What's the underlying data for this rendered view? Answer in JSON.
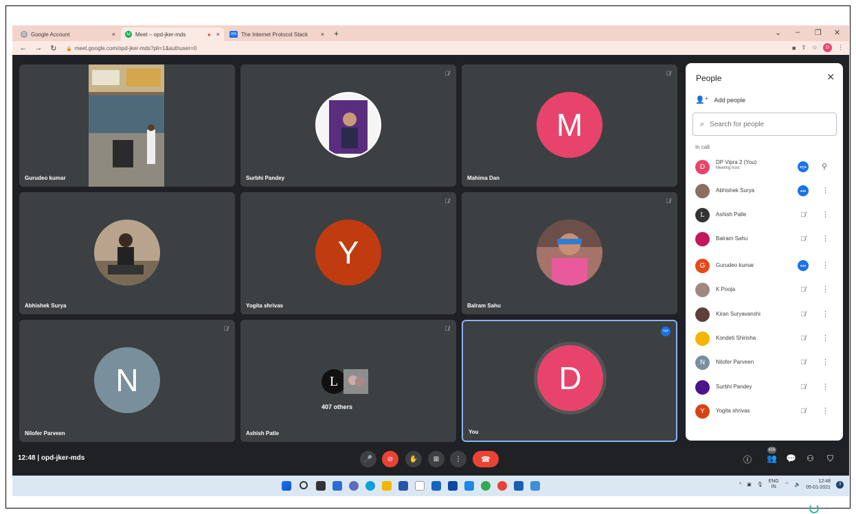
{
  "browser": {
    "tabs": [
      {
        "label": "Google Account",
        "favicon": "G",
        "color": "#9aa0a6",
        "close": "×"
      },
      {
        "label": "Meet – opd-jker-mds",
        "favicon": "M",
        "color": "#00ac47",
        "close": "×",
        "recording": "●"
      },
      {
        "label": "The Internet Protocol Stack",
        "favicon": "WS",
        "color": "#1a73e8",
        "close": "×"
      }
    ],
    "new_tab": "+",
    "url": "meet.google.com/opd-jker-mds?pli=1&authuser=0",
    "profile_initial": "D"
  },
  "tiles": [
    {
      "name": "Gurudeo kumar",
      "type": "video"
    },
    {
      "name": "Surbhi Pandey",
      "type": "photo"
    },
    {
      "name": "Mahima Dan",
      "type": "letter",
      "letter": "M",
      "color": "#e8446b"
    },
    {
      "name": "Abhishek Surya",
      "type": "photo"
    },
    {
      "name": "Yogita shrivas",
      "type": "letter",
      "letter": "Y",
      "color": "#c13b10"
    },
    {
      "name": "Balram Sahu",
      "type": "photo"
    },
    {
      "name": "Nilofer Parveen",
      "type": "letter",
      "letter": "N",
      "color": "#78909c"
    },
    {
      "name": "Ashish Patle",
      "type": "others",
      "others": "407 others"
    },
    {
      "name": "You",
      "type": "letter",
      "letter": "D",
      "color": "#e8446b"
    }
  ],
  "people_panel": {
    "title": "People",
    "add_people": "Add people",
    "search_placeholder": "Search for people",
    "section": "In call",
    "participants": [
      {
        "name": "DP Vipra 2 (You)",
        "sub": "Meeting host",
        "initial": "D",
        "color": "#e8446b",
        "status": "talking"
      },
      {
        "name": "Abhishek Surya",
        "initial": "",
        "color": "#8d6e63",
        "status": "talking"
      },
      {
        "name": "Ashish Patle",
        "initial": "L",
        "color": "#333333",
        "status": "muted"
      },
      {
        "name": "Balram Sahu",
        "initial": "",
        "color": "#c2185b",
        "status": "muted"
      },
      {
        "name": "Gurudeo kumar",
        "initial": "G",
        "color": "#e64a19",
        "status": "talking"
      },
      {
        "name": "K Pooja",
        "initial": "",
        "color": "#a1887f",
        "status": "muted"
      },
      {
        "name": "Kiran Suryavanshi",
        "initial": "",
        "color": "#5d4037",
        "status": "muted"
      },
      {
        "name": "Kondeti Shirisha",
        "initial": "",
        "color": "#f4b400",
        "status": "muted"
      },
      {
        "name": "Nilofer Parveen",
        "initial": "N",
        "color": "#78909c",
        "status": "muted"
      },
      {
        "name": "Surbhi Pandey",
        "initial": "",
        "color": "#4a148c",
        "status": "muted"
      },
      {
        "name": "Yogita shrivas",
        "initial": "Y",
        "color": "#d84315",
        "status": "muted"
      }
    ]
  },
  "bottom_bar": {
    "time_meeting": "12:48  |  opd-jker-mds",
    "people_count": "416"
  },
  "taskbar": {
    "lang_line1": "ENG",
    "lang_line2": "IN",
    "time": "12:48",
    "date": "05-01-2021",
    "notifications": "3"
  }
}
